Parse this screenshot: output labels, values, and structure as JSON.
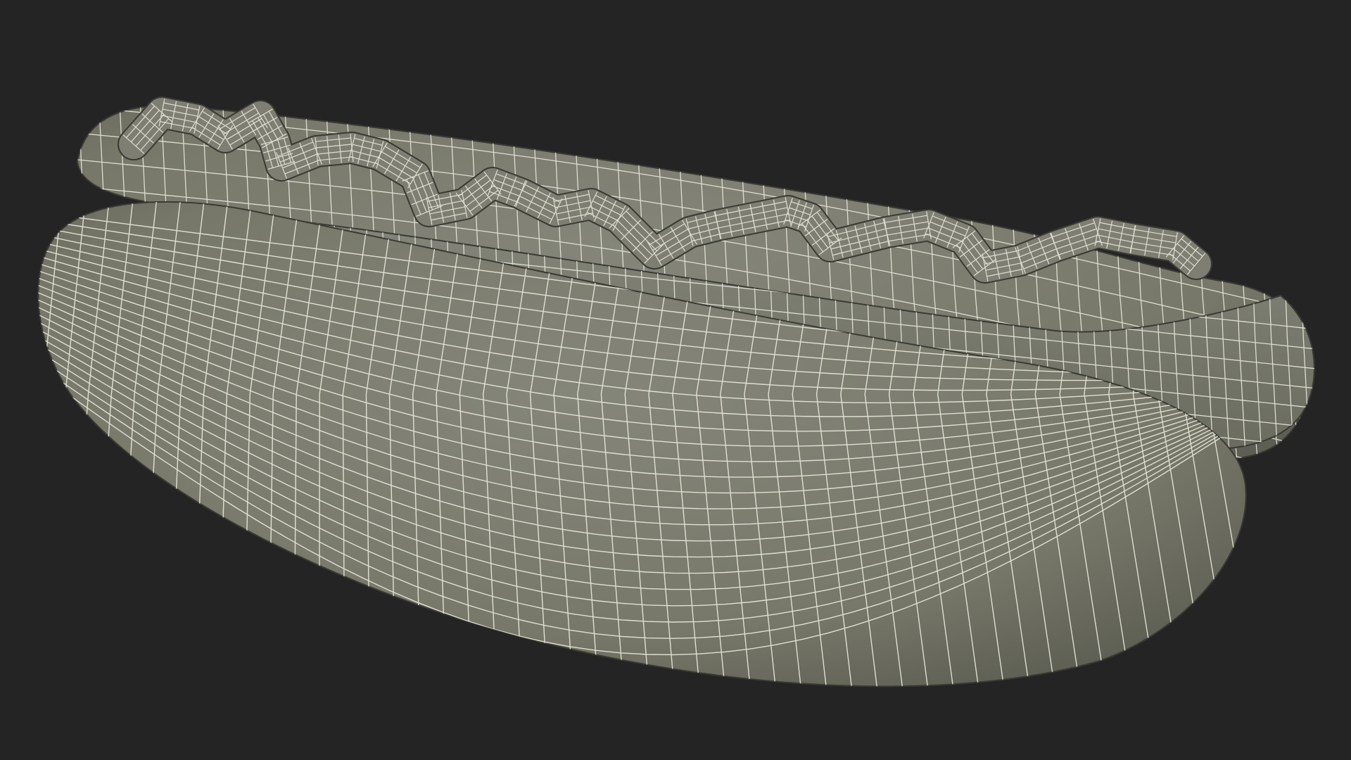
{
  "viewport": {
    "background": "#242424",
    "model": "hot-dog-wireframe",
    "render_style": "wireframe-on-shaded",
    "colors": {
      "surface": "#7c7d70",
      "surface_dark": "#5f6055",
      "surface_light": "#8e8f82",
      "wire": "#e8e8dc",
      "outline": "#3a3a34"
    }
  }
}
